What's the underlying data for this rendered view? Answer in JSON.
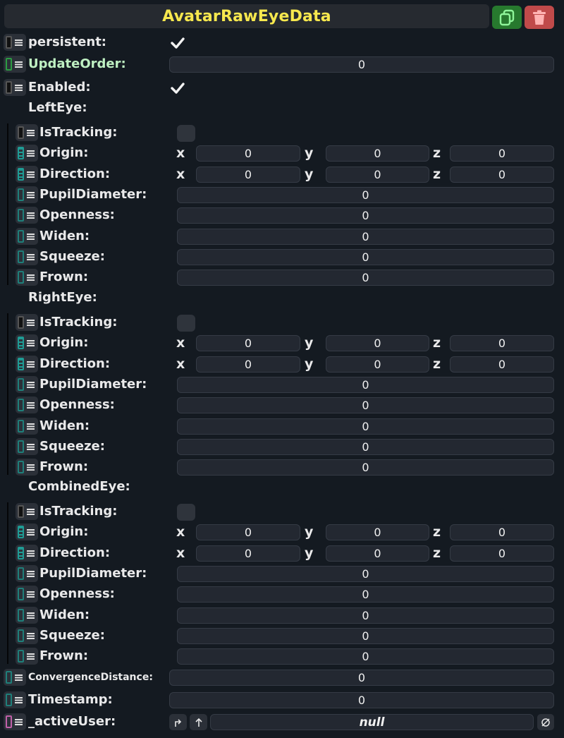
{
  "header": {
    "title": "AvatarRawEyeData"
  },
  "icons": {
    "duplicate": "duplicate-icon",
    "delete": "trash-icon"
  },
  "colors": {
    "title": "#f7e84e",
    "duplicate_bg": "#27792e",
    "delete_bg": "#c04a4a",
    "update_order_label": "#bff0c2"
  },
  "fields": {
    "persistent": {
      "label": "persistent:",
      "checked": true
    },
    "update_order": {
      "label": "UpdateOrder:",
      "value": "0"
    },
    "enabled": {
      "label": "Enabled:",
      "checked": true
    },
    "convergence_distance": {
      "label": "ConvergenceDistance:",
      "value": "0"
    },
    "timestamp": {
      "label": "Timestamp:",
      "value": "0"
    },
    "active_user": {
      "label": "_activeUser:",
      "value": "null"
    }
  },
  "axes": {
    "x": "x",
    "y": "y",
    "z": "z"
  },
  "eyes": [
    {
      "title": "LeftEye:",
      "is_tracking": {
        "label": "IsTracking:",
        "checked": false
      },
      "origin": {
        "label": "Origin:",
        "x": "0",
        "y": "0",
        "z": "0"
      },
      "direction": {
        "label": "Direction:",
        "x": "0",
        "y": "0",
        "z": "0"
      },
      "pupil_diameter": {
        "label": "PupilDiameter:",
        "value": "0"
      },
      "openness": {
        "label": "Openness:",
        "value": "0"
      },
      "widen": {
        "label": "Widen:",
        "value": "0"
      },
      "squeeze": {
        "label": "Squeeze:",
        "value": "0"
      },
      "frown": {
        "label": "Frown:",
        "value": "0"
      }
    },
    {
      "title": "RightEye:",
      "is_tracking": {
        "label": "IsTracking:",
        "checked": false
      },
      "origin": {
        "label": "Origin:",
        "x": "0",
        "y": "0",
        "z": "0"
      },
      "direction": {
        "label": "Direction:",
        "x": "0",
        "y": "0",
        "z": "0"
      },
      "pupil_diameter": {
        "label": "PupilDiameter:",
        "value": "0"
      },
      "openness": {
        "label": "Openness:",
        "value": "0"
      },
      "widen": {
        "label": "Widen:",
        "value": "0"
      },
      "squeeze": {
        "label": "Squeeze:",
        "value": "0"
      },
      "frown": {
        "label": "Frown:",
        "value": "0"
      }
    },
    {
      "title": "CombinedEye:",
      "is_tracking": {
        "label": "IsTracking:",
        "checked": false
      },
      "origin": {
        "label": "Origin:",
        "x": "0",
        "y": "0",
        "z": "0"
      },
      "direction": {
        "label": "Direction:",
        "x": "0",
        "y": "0",
        "z": "0"
      },
      "pupil_diameter": {
        "label": "PupilDiameter:",
        "value": "0"
      },
      "openness": {
        "label": "Openness:",
        "value": "0"
      },
      "widen": {
        "label": "Widen:",
        "value": "0"
      },
      "squeeze": {
        "label": "Squeeze:",
        "value": "0"
      },
      "frown": {
        "label": "Frown:",
        "value": "0"
      }
    }
  ]
}
